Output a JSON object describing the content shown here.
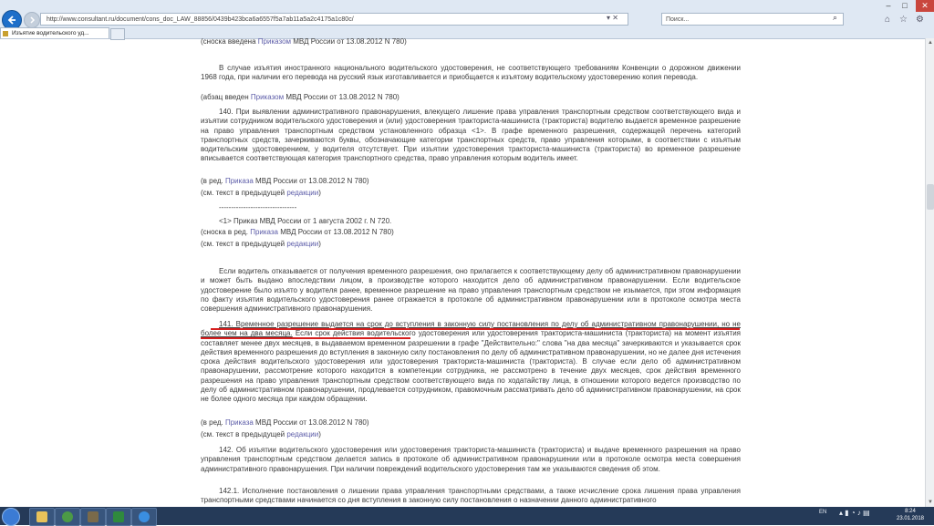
{
  "browser": {
    "url": "http://www.consultant.ru/document/cons_doc_LAW_88856/0439b423bca6a6557f5a7ab11a5a2c4175a1c80c/",
    "search_placeholder": "Поиск...",
    "tab_title": "Изъятие водительского уд..."
  },
  "document": {
    "p0": "(сноска введена Приказом МВД России от 13.08.2012 N 780)",
    "p1": "В случае изъятия иностранного национального водительского удостоверения, не соответствующего требованиям Конвенции о дорожном движении 1968 года, при наличии его перевода на русский язык изготавливается и приобщается к изъятому водительскому удостоверению копия перевода.",
    "p1b": "(абзац введен Приказом МВД России от 13.08.2012 N 780)",
    "p2": "140. При выявлении административного правонарушения, влекущего лишение права управления транспортным средством соответствующего вида и изъятии сотрудником водительского удостоверения и (или) удостоверения тракториста-машиниста (тракториста) водителю выдается временное разрешение на право управления транспортным средством установленного образца <1>. В графе временного разрешения, содержащей перечень категорий транспортных средств, зачеркиваются буквы, обозначающие категории транспортных средств, право управления которыми, в соответствии с изъятым водительским удостоверением, у водителя отсутствует. При изъятии удостоверения тракториста-машиниста (тракториста) во временное разрешение вписывается соответствующая категория транспортного средства, право управления которым водитель имеет.",
    "p2b": "(в ред. Приказа МВД России от 13.08.2012 N 780)",
    "p2c": "(см. текст в предыдущей редакции)",
    "sep": "--------------------------------",
    "fn1": "<1> Приказ МВД России от 1 августа 2002 г. N 720.",
    "fn1b": "(сноска в ред. Приказа МВД России от 13.08.2012 N 780)",
    "fn1c": "(см. текст в предыдущей редакции)",
    "p3": "Если водитель отказывается от получения временного разрешения, оно прилагается к соответствующему делу об административном правонарушении и может быть выдано впоследствии лицом, в производстве которого находится дело об административном правонарушении. Если водительское удостоверение было изъято у водителя ранее, временное разрешение на право управления транспортным средством не изымается, при этом информация по факту изъятия водительского удостоверения ранее отражается в протоколе об административном правонарушении или в протоколе осмотра места совершения административного правонарушения.",
    "p4_highlight": "141. Временное разрешение выдается на срок до вступления в законную силу постановления по делу об административном правонарушении, но не более чем на два месяца.",
    "p4_rest": " Если срок действия водительского удостоверения или удостоверения тракториста-машиниста (тракториста) на момент изъятия составляет менее двух месяцев, в выдаваемом временном разрешении в графе \"Действительно:\" слова \"на два месяца\" зачеркиваются и указывается срок действия временного разрешения до вступления в законную силу постановления по делу об административном правонарушении, но не далее дня истечения срока действия водительского удостоверения или удостоверения тракториста-машиниста (тракториста). В случае если дело об административном правонарушении, рассмотрение которого находится в компетенции сотрудника, не рассмотрено в течение двух месяцев, срок действия временного разрешения на право управления транспортным средством соответствующего вида по ходатайству лица, в отношении которого ведется производство по делу об административном правонарушении, продлевается сотрудником, правомочным рассматривать дело об административном правонарушении, на срок не более одного месяца при каждом обращении.",
    "p4b": "(в ред. Приказа МВД России от 13.08.2012 N 780)",
    "p4c": "(см. текст в предыдущей редакции)",
    "p5": "142. Об изъятии водительского удостоверения или удостоверения тракториста-машиниста (тракториста) и выдаче временного разрешения на право управления транспортным средством делается запись в протоколе об административном правонарушении или в протоколе осмотра места совершения административного правонарушения. При наличии повреждений водительского удостоверения там же указываются сведения об этом.",
    "p6": "142.1. Исполнение постановления о лишении права управления транспортными средствами, а также исчисление срока лишения права управления транспортными средствами начинается со дня вступления в законную силу постановления о назначении данного административного"
  },
  "taskbar": {
    "lang": "EN",
    "time": "8:24",
    "date": "23.01.2018"
  },
  "colors": {
    "link": "#5c5ca8",
    "underline_accent": "#d61f1f",
    "taskbar": "#253a58"
  }
}
